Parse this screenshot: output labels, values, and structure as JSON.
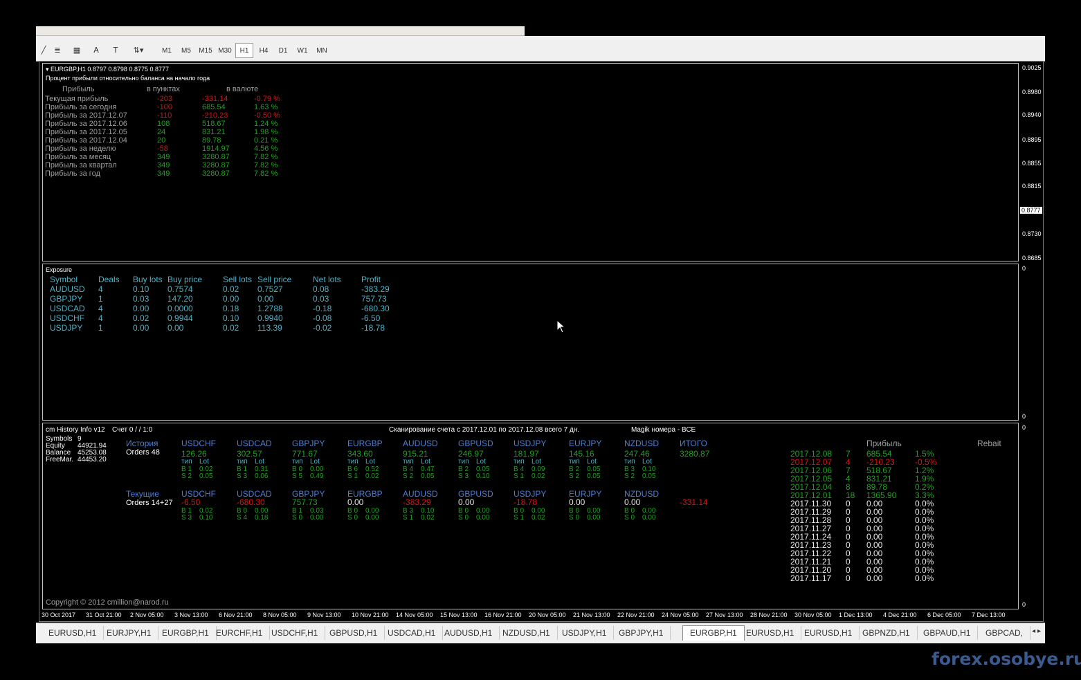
{
  "toolbar": {
    "timeframes": [
      "M1",
      "M5",
      "M15",
      "M30",
      "H1",
      "H4",
      "D1",
      "W1",
      "MN"
    ],
    "active_timeframe": "H1",
    "tool_icons": [
      "cursor-icon",
      "line-icon",
      "fibonacci-icon",
      "grid-icon",
      "text-icon",
      "label-icon",
      "arrows-icon"
    ]
  },
  "chart": {
    "header": "EURGBP,H1  0.8797 0.8798 0.8775 0.8777",
    "subtitle": "Процент прибыли относительно баланса на начало года",
    "profit_header": {
      "col1": "Прибыль",
      "col2": "в пунктах",
      "col3": "в валюте"
    },
    "profit_rows": [
      {
        "label": "Текущая прибыль",
        "points": "-203",
        "money": "-331.14",
        "pct": "-0.79 %",
        "color": "red"
      },
      {
        "label": "Прибыль за сегодня",
        "points": "-100",
        "money": "685.54",
        "pct": "1.63 %",
        "color": "mixed"
      },
      {
        "label": "Прибыль за 2017.12.07",
        "points": "-110",
        "money": "-210.23",
        "pct": "-0.50 %",
        "color": "red"
      },
      {
        "label": "Прибыль за 2017.12.06",
        "points": "108",
        "money": "518.67",
        "pct": "1.24 %",
        "color": "green"
      },
      {
        "label": "Прибыль за 2017.12.05",
        "points": "24",
        "money": "831.21",
        "pct": "1.98 %",
        "color": "green"
      },
      {
        "label": "Прибыль за 2017.12.04",
        "points": "20",
        "money": "89.78",
        "pct": "0.21 %",
        "color": "green"
      },
      {
        "label": "Прибыль за неделю",
        "points": "-58",
        "money": "1914.97",
        "pct": "4.56 %",
        "color": "mixed"
      },
      {
        "label": "Прибыль за месяц",
        "points": "349",
        "money": "3280.87",
        "pct": "7.82 %",
        "color": "green"
      },
      {
        "label": "Прибыль за квартал",
        "points": "349",
        "money": "3280.87",
        "pct": "7.82 %",
        "color": "green"
      },
      {
        "label": "Прибыль за год",
        "points": "349",
        "money": "3280.87",
        "pct": "7.82 %",
        "color": "green"
      }
    ],
    "price_scale": [
      "0.9025",
      "0.8980",
      "0.8940",
      "0.8895",
      "0.8855",
      "0.8815",
      "0.8777",
      "0.8730",
      "0.8685"
    ],
    "current_price": "0.8777",
    "pane2_scale": [
      "0",
      "0"
    ],
    "pane3_scale": [
      "0",
      "0"
    ],
    "time_axis": [
      "30 Oct 2017",
      "31 Oct 21:00",
      "2 Nov 05:00",
      "3 Nov 13:00",
      "6 Nov 21:00",
      "8 Nov 05:00",
      "9 Nov 13:00",
      "10 Nov 21:00",
      "14 Nov 05:00",
      "15 Nov 13:00",
      "16 Nov 21:00",
      "20 Nov 05:00",
      "21 Nov 13:00",
      "22 Nov 21:00",
      "24 Nov 05:00",
      "27 Nov 13:00",
      "28 Nov 21:00",
      "30 Nov 05:00",
      "1 Dec 13:00",
      "4 Dec 21:00",
      "6 Dec 05:00",
      "7 Dec 13:00"
    ]
  },
  "exposure": {
    "title": "Exposure",
    "headers": [
      "Symbol",
      "Deals",
      "Buy lots",
      "Buy price",
      "Sell lots",
      "Sell price",
      "Net lots",
      "Profit"
    ],
    "rows": [
      [
        "AUDUSD",
        "4",
        "0.10",
        "0.7574",
        "0.02",
        "0.7527",
        "0.08",
        "-383.29"
      ],
      [
        "GBPJPY",
        "1",
        "0.03",
        "147.20",
        "0.00",
        "0.00",
        "0.03",
        "757.73"
      ],
      [
        "USDCAD",
        "4",
        "0.00",
        "0.0000",
        "0.18",
        "1.2788",
        "-0.18",
        "-680.30"
      ],
      [
        "USDCHF",
        "4",
        "0.02",
        "0.9944",
        "0.10",
        "0.9940",
        "-0.08",
        "-6.50"
      ],
      [
        "USDJPY",
        "1",
        "0.00",
        "0.00",
        "0.02",
        "113.39",
        "-0.02",
        "-18.78"
      ]
    ]
  },
  "history": {
    "title": "cm History Info v12",
    "account": "Счет 0 /  / 1:0",
    "scan": "Сканирование счета с 2017.12.01 по 2017.12.08 всего 7 дн.",
    "magic": "Magik номера - ВСЕ",
    "stats": [
      {
        "label": "Symbols",
        "value": "9"
      },
      {
        "label": "Equity",
        "value": "44921.94"
      },
      {
        "label": "Balance",
        "value": "45253.08"
      },
      {
        "label": "FreeMar.",
        "value": "44453.20"
      }
    ],
    "history_label": "История",
    "history_orders": "Orders 48",
    "current_label": "Текущие",
    "current_orders": "Orders 14+27",
    "type_label": "тип",
    "lot_label": "Lot",
    "total_label": "ИТОГО",
    "total_history": "3280.87",
    "total_current": "-331.14",
    "symbols": [
      {
        "name": "USDCHF",
        "hist": "126.26",
        "hb": "B 1",
        "hbl": "0.02",
        "hs": "S 2",
        "hsl": "0.05",
        "cur": "-6.50",
        "curc": "red",
        "cb": "B 1",
        "cbl": "0.02",
        "cs": "S 3",
        "csl": "0.10"
      },
      {
        "name": "USDCAD",
        "hist": "302.57",
        "hb": "B 1",
        "hbl": "0.31",
        "hs": "S 3",
        "hsl": "0.06",
        "cur": "-680.30",
        "curc": "red",
        "cb": "B 0",
        "cbl": "0.00",
        "cs": "S 4",
        "csl": "0.18"
      },
      {
        "name": "GBPJPY",
        "hist": "771.67",
        "hb": "B 0",
        "hbl": "0.00",
        "hs": "S 5",
        "hsl": "0.49",
        "cur": "757.73",
        "curc": "green",
        "cb": "B 1",
        "cbl": "0.03",
        "cs": "S 0",
        "csl": "0.00"
      },
      {
        "name": "EURGBP",
        "hist": "343.60",
        "hb": "B 6",
        "hbl": "0.52",
        "hs": "S 1",
        "hsl": "0.02",
        "cur": "0.00",
        "curc": "white",
        "cb": "B 0",
        "cbl": "0.00",
        "cs": "S 0",
        "csl": "0.00"
      },
      {
        "name": "AUDUSD",
        "hist": "915.21",
        "hb": "B 4",
        "hbl": "0.47",
        "hs": "S 2",
        "hsl": "0.05",
        "cur": "-383.29",
        "curc": "red",
        "cb": "B 3",
        "cbl": "0.10",
        "cs": "S 1",
        "csl": "0.02"
      },
      {
        "name": "GBPUSD",
        "hist": "246.97",
        "hb": "B 2",
        "hbl": "0.05",
        "hs": "S 3",
        "hsl": "0.10",
        "cur": "0.00",
        "curc": "white",
        "cb": "B 0",
        "cbl": "0.00",
        "cs": "S 0",
        "csl": "0.00"
      },
      {
        "name": "USDJPY",
        "hist": "181.97",
        "hb": "B 4",
        "hbl": "0.09",
        "hs": "S 1",
        "hsl": "0.02",
        "cur": "-18.78",
        "curc": "red",
        "cb": "B 0",
        "cbl": "0.00",
        "cs": "S 1",
        "csl": "0.02"
      },
      {
        "name": "EURJPY",
        "hist": "145.16",
        "hb": "B 2",
        "hbl": "0.05",
        "hs": "S 2",
        "hsl": "0.05",
        "cur": "0.00",
        "curc": "white",
        "cb": "B 0",
        "cbl": "0.00",
        "cs": "S 0",
        "csl": "0.00"
      },
      {
        "name": "NZDUSD",
        "hist": "247.46",
        "hb": "B 3",
        "hbl": "0.10",
        "hs": "S 2",
        "hsl": "0.05",
        "cur": "0.00",
        "curc": "white",
        "cb": "B 0",
        "cbl": "0.00",
        "cs": "S 0",
        "csl": "0.00"
      }
    ],
    "days_header": "Прибыль",
    "rebait_label": "Rebait",
    "days": [
      {
        "date": "2017.12.08",
        "n": "7",
        "p": "685.54",
        "pct": "1.5%",
        "c": "green"
      },
      {
        "date": "2017.12.07",
        "n": "4",
        "p": "-210.23",
        "pct": "-0.5%",
        "c": "red"
      },
      {
        "date": "2017.12.06",
        "n": "7",
        "p": "518.67",
        "pct": "1.2%",
        "c": "green"
      },
      {
        "date": "2017.12.05",
        "n": "4",
        "p": "831.21",
        "pct": "1.9%",
        "c": "green"
      },
      {
        "date": "2017.12.04",
        "n": "8",
        "p": "89.78",
        "pct": "0.2%",
        "c": "green"
      },
      {
        "date": "2017.12.01",
        "n": "18",
        "p": "1365.90",
        "pct": "3.3%",
        "c": "green"
      },
      {
        "date": "2017.11.30",
        "n": "0",
        "p": "0.00",
        "pct": "0.0%",
        "c": "white"
      },
      {
        "date": "2017.11.29",
        "n": "0",
        "p": "0.00",
        "pct": "0.0%",
        "c": "white"
      },
      {
        "date": "2017.11.28",
        "n": "0",
        "p": "0.00",
        "pct": "0.0%",
        "c": "white"
      },
      {
        "date": "2017.11.27",
        "n": "0",
        "p": "0.00",
        "pct": "0.0%",
        "c": "white"
      },
      {
        "date": "2017.11.24",
        "n": "0",
        "p": "0.00",
        "pct": "0.0%",
        "c": "white"
      },
      {
        "date": "2017.11.23",
        "n": "0",
        "p": "0.00",
        "pct": "0.0%",
        "c": "white"
      },
      {
        "date": "2017.11.22",
        "n": "0",
        "p": "0.00",
        "pct": "0.0%",
        "c": "white"
      },
      {
        "date": "2017.11.21",
        "n": "0",
        "p": "0.00",
        "pct": "0.0%",
        "c": "white"
      },
      {
        "date": "2017.11.20",
        "n": "0",
        "p": "0.00",
        "pct": "0.0%",
        "c": "white"
      },
      {
        "date": "2017.11.17",
        "n": "0",
        "p": "0.00",
        "pct": "0.0%",
        "c": "white"
      }
    ],
    "copyright": "Copyright © 2012 cmillion@narod.ru"
  },
  "tabs": [
    "EURUSD,H1",
    "EURJPY,H1",
    "EURGBP,H1",
    "EURCHF,H1",
    "USDCHF,H1",
    "GBPUSD,H1",
    "USDCAD,H1",
    "AUDUSD,H1",
    "NZDUSD,H1",
    "USDJPY,H1",
    "GBPJPY,H1",
    "EURGBP,H1",
    "EURUSD,H1",
    "EURUSD,H1",
    "GBPNZD,H1",
    "GBPAUD,H1",
    "GBPCAD,"
  ],
  "active_tab_index": 11,
  "watermark": "forex.osobye.ru",
  "colors": {
    "green": "#1fa31f",
    "red": "#e01010",
    "teal": "#4bb3c9",
    "blue": "#4c7fd6"
  }
}
